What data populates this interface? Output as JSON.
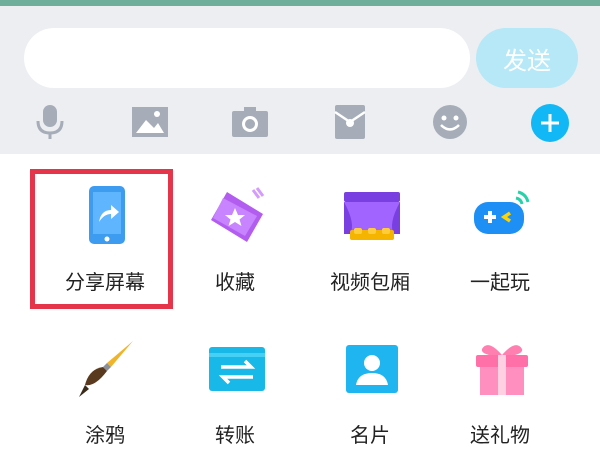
{
  "composer": {
    "input_value": "",
    "send_label": "发送"
  },
  "toolbar": {
    "icons": [
      "microphone-icon",
      "image-icon",
      "camera-icon",
      "red-packet-icon",
      "emoji-icon",
      "plus-icon"
    ]
  },
  "panel": {
    "items": [
      {
        "label": "分享屏幕",
        "icon": "share-screen-icon"
      },
      {
        "label": "收藏",
        "icon": "favorites-icon"
      },
      {
        "label": "视频包厢",
        "icon": "video-box-icon"
      },
      {
        "label": "一起玩",
        "icon": "game-controller-icon"
      },
      {
        "label": "涂鸦",
        "icon": "paintbrush-icon"
      },
      {
        "label": "转账",
        "icon": "transfer-icon"
      },
      {
        "label": "名片",
        "icon": "contact-card-icon"
      },
      {
        "label": "送礼物",
        "icon": "gift-icon"
      }
    ]
  },
  "colors": {
    "accent": "#12b7f5",
    "send_button_bg": "#b6e8f7",
    "highlight_border": "#e5354a",
    "toolbar_icon": "#a6adb8"
  }
}
